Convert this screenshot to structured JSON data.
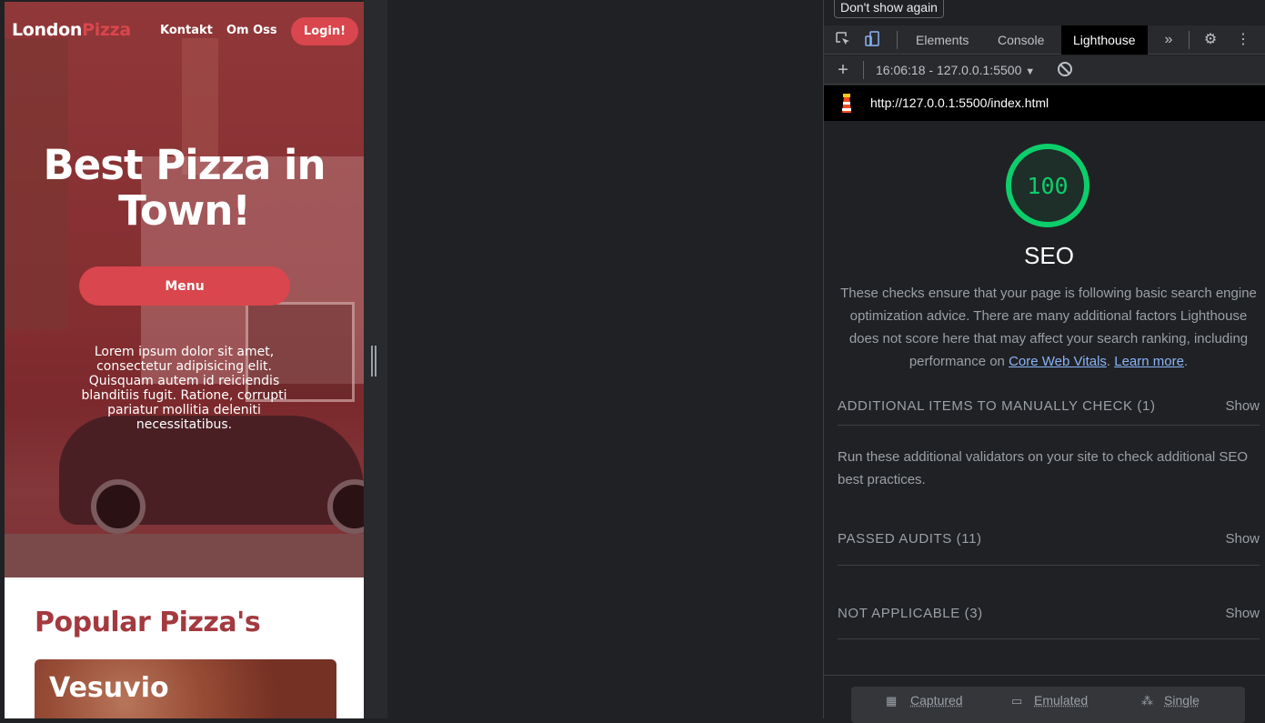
{
  "site": {
    "logo_main": "London",
    "logo_accent": "Pizza",
    "nav": {
      "kontakt": "Kontakt",
      "om_oss": "Om Oss",
      "login": "Login!"
    },
    "hero": {
      "title": "Best Pizza in Town!",
      "menu_button": "Menu",
      "text": "Lorem ipsum dolor sit amet, consectetur adipisicing elit. Quisquam autem id reiciendis blanditiis fugit. Ratione, corrupti pariatur mollitia deleniti necessitatibus."
    },
    "popular_title": "Popular Pizza's",
    "card_title": "Vesuvio",
    "colors": {
      "accent": "#d9464d",
      "section_title": "#a33a3f"
    }
  },
  "devtools": {
    "dont_show_again": "Don't show again",
    "tabs": [
      "Elements",
      "Console",
      "Lighthouse"
    ],
    "active_tab": "Lighthouse",
    "report_selector": "16:06:18 - 127.0.0.1:5500",
    "url": "http://127.0.0.1:5500/index.html",
    "score": "100",
    "category_title": "SEO",
    "description_prefix": "These checks ensure that your page is following basic search engine optimization advice. There are many additional factors Lighthouse does not score here that may affect your search ranking, including performance on",
    "link_core_web_vitals": "Core Web Vitals",
    "link_learn_more": "Learn more",
    "groups": [
      {
        "title": "ADDITIONAL ITEMS TO MANUALLY CHECK (1)",
        "action": "Show"
      },
      {
        "title": "PASSED AUDITS (11)",
        "action": "Show"
      },
      {
        "title": "NOT APPLICABLE (3)",
        "action": "Show"
      }
    ],
    "manual_check_desc": "Run these additional validators on your site to check additional SEO best practices.",
    "footer": {
      "captured": "Captured",
      "emulated": "Emulated",
      "single": "Single"
    },
    "colors": {
      "score_green": "#0cce6b",
      "link": "#8ab4f8"
    },
    "icons": [
      "inspect-icon",
      "device-toggle-icon",
      "more-tabs-icon",
      "settings-gear-icon",
      "kebab-menu-icon",
      "plus-icon",
      "dropdown-arrow-icon",
      "clear-icon",
      "lighthouse-icon",
      "calendar-icon",
      "device-icon",
      "single-icon"
    ]
  }
}
